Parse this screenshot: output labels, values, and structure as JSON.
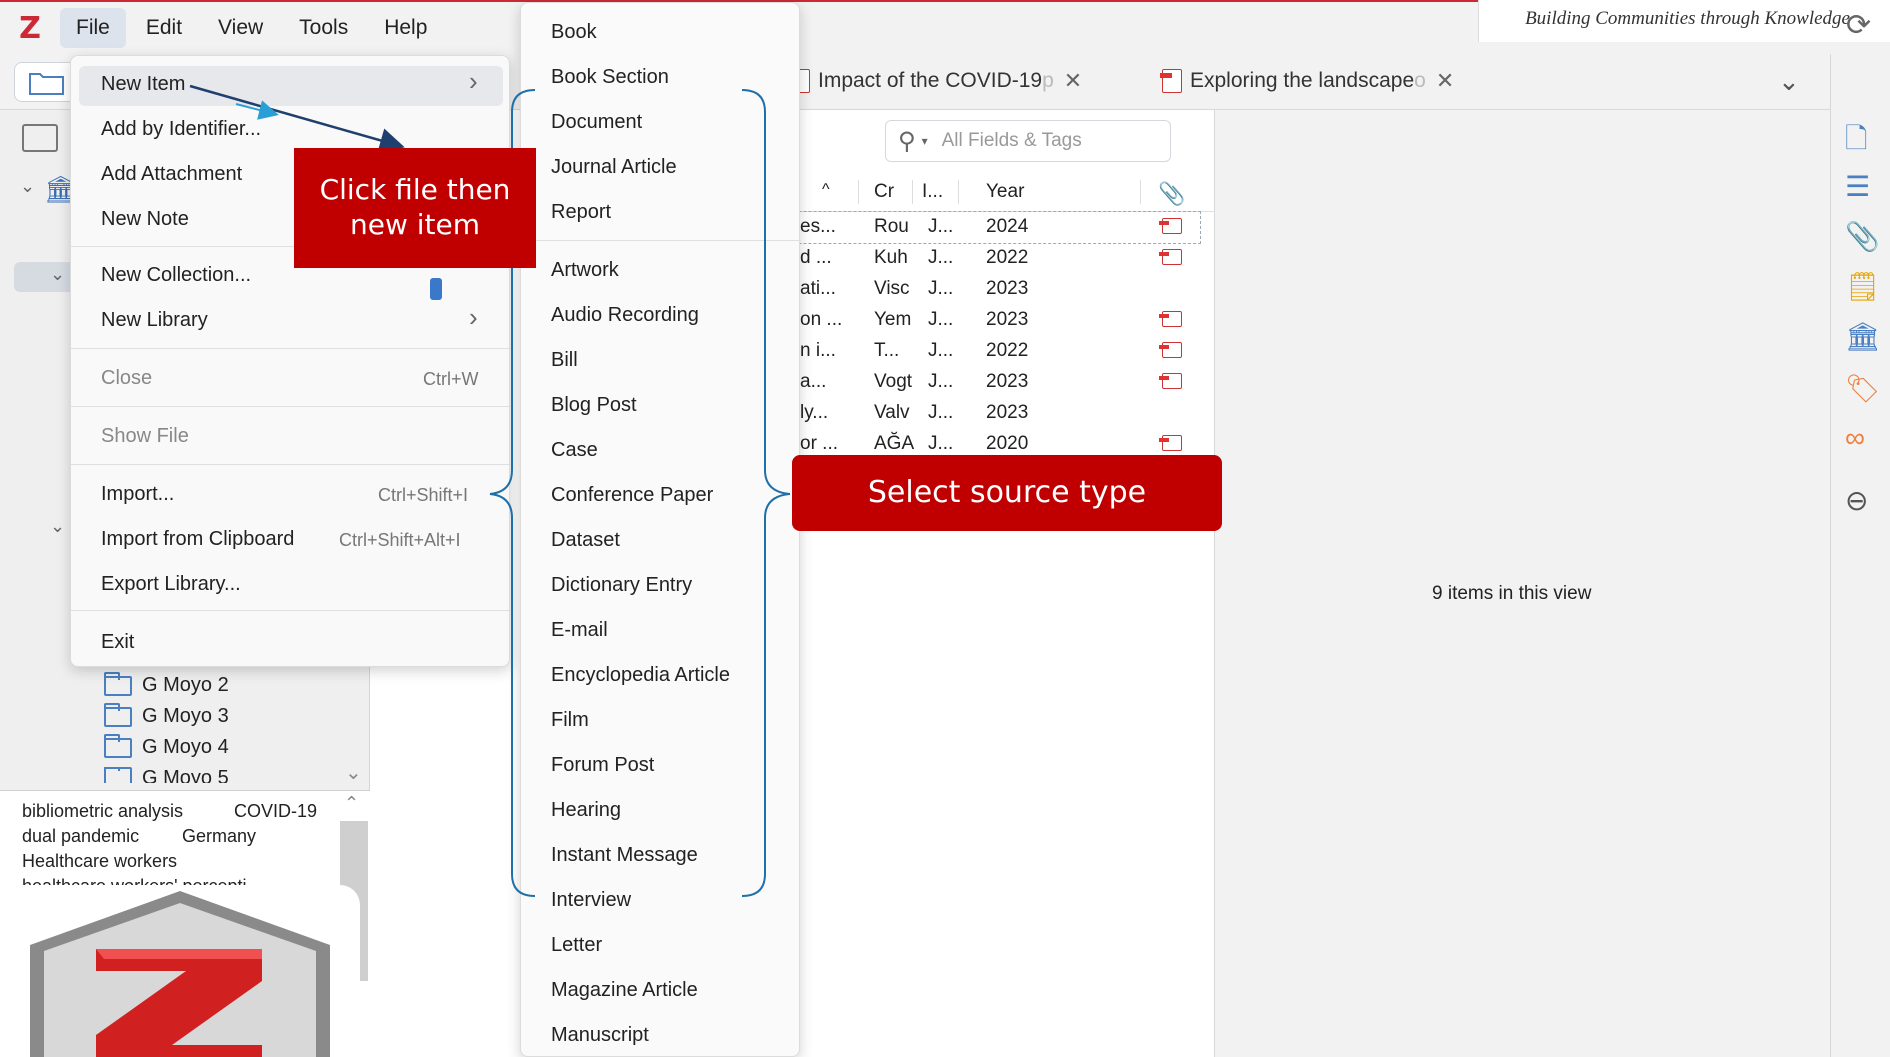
{
  "menubar": {
    "logo": "Z",
    "items": [
      "File",
      "Edit",
      "View",
      "Tools",
      "Help"
    ]
  },
  "caption": "Building Communities through Knowledge",
  "tabs": [
    {
      "title": "Impact of the COVID-19 ",
      "faded": "p"
    },
    {
      "title": "Exploring the landscape ",
      "faded": "o"
    }
  ],
  "file_menu": {
    "items": [
      {
        "label": "New Item",
        "shortcut": "",
        "submenu": true,
        "disabled": false
      },
      {
        "label": "Add by Identifier...",
        "shortcut": "",
        "submenu": false,
        "disabled": false
      },
      {
        "label": "Add Attachment",
        "shortcut": "",
        "submenu": false,
        "disabled": false
      },
      {
        "label": "New Note",
        "shortcut": "",
        "submenu": false,
        "disabled": false
      },
      {
        "label": "New Collection...",
        "shortcut": "",
        "submenu": false,
        "disabled": false
      },
      {
        "label": "New Library",
        "shortcut": "",
        "submenu": true,
        "disabled": false
      },
      {
        "label": "Close",
        "shortcut": "Ctrl+W",
        "submenu": false,
        "disabled": true
      },
      {
        "label": "Show File",
        "shortcut": "",
        "submenu": false,
        "disabled": true
      },
      {
        "label": "Import...",
        "shortcut": "Ctrl+Shift+I",
        "submenu": false,
        "disabled": false
      },
      {
        "label": "Import from Clipboard",
        "shortcut": "Ctrl+Shift+Alt+I",
        "submenu": false,
        "disabled": false
      },
      {
        "label": "Export Library...",
        "shortcut": "",
        "submenu": false,
        "disabled": false
      },
      {
        "label": "Exit",
        "shortcut": "",
        "submenu": false,
        "disabled": false
      }
    ]
  },
  "new_item_submenu": [
    "Book",
    "Book Section",
    "Document",
    "Journal Article",
    "Report",
    "Artwork",
    "Audio Recording",
    "Bill",
    "Blog Post",
    "Case",
    "Conference Paper",
    "Dataset",
    "Dictionary Entry",
    "E-mail",
    "Encyclopedia Article",
    "Film",
    "Forum Post",
    "Hearing",
    "Instant Message",
    "Interview",
    "Letter",
    "Magazine Article",
    "Manuscript"
  ],
  "annotations": {
    "callout1": "Click file  then new item",
    "callout2": "Select source type"
  },
  "search": {
    "placeholder": "All Fields & Tags"
  },
  "columns": {
    "creator": "Cr",
    "item_type": "I...",
    "year": "Year"
  },
  "rows": [
    {
      "title": "es...",
      "creator": "Rou",
      "type": "J...",
      "year": "2024",
      "attachment": true
    },
    {
      "title": "d ...",
      "creator": "Kuh",
      "type": "J...",
      "year": "2022",
      "attachment": true
    },
    {
      "title": "ati...",
      "creator": "Visc",
      "type": "J...",
      "year": "2023",
      "attachment": false
    },
    {
      "title": "on ...",
      "creator": "Yem",
      "type": "J...",
      "year": "2023",
      "attachment": true
    },
    {
      "title": "n i...",
      "creator": "T...",
      "type": "J...",
      "year": "2022",
      "attachment": true
    },
    {
      "title": "a...",
      "creator": "Vogt",
      "type": "J...",
      "year": "2023",
      "attachment": true
    },
    {
      "title": "ly...",
      "creator": "Valv",
      "type": "J...",
      "year": "2023",
      "attachment": false
    },
    {
      "title": "or ...",
      "creator": "AĞA",
      "type": "J...",
      "year": "2020",
      "attachment": true
    }
  ],
  "item_count": "9 items in this view",
  "collections": [
    "G Moyo 2",
    "G Moyo 3",
    "G Moyo 4",
    "G Moyo 5"
  ],
  "tags": [
    "bibliometric analysis",
    "COVID-19",
    "dual pandemic",
    "Germany",
    "Healthcare workers",
    "healthcare workers' percepti"
  ],
  "colors": {
    "accent": "#cc2936",
    "callout": "#c00000",
    "bracket": "#1f6fa8"
  }
}
